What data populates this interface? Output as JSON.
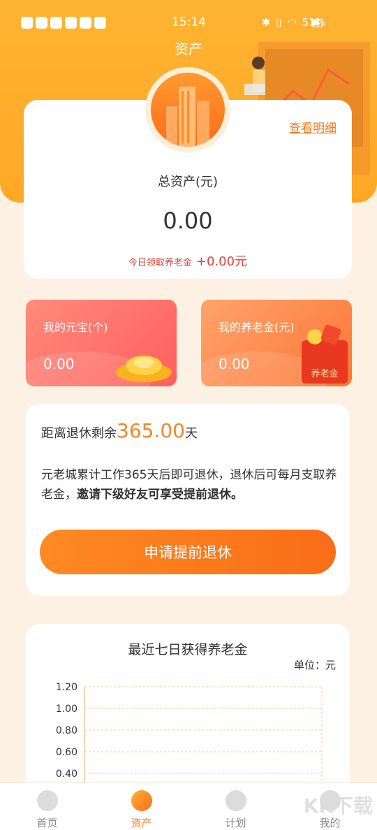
{
  "status_bar": {
    "time": "15:14",
    "battery": "51%"
  },
  "page_title": "资产",
  "asset_card": {
    "detail_link": "查看明细",
    "total_label": "总资产(元)",
    "total_value": "0.00",
    "today_label": "今日领取养老金",
    "today_value": "+0.00元"
  },
  "mini_cards": [
    {
      "label": "我的元宝(个)",
      "value": "0.00"
    },
    {
      "label": "我的养老金(元)",
      "value": "0.00",
      "badge": "养老金"
    }
  ],
  "retire_card": {
    "remain_prefix": "距离退休剩余",
    "remain_days": "365.00",
    "remain_suffix": "天",
    "desc_normal": "元老城累计工作365天后即可退休，退休后可每月支取养老金，",
    "desc_bold": "邀请下级好友可享受提前退休。",
    "apply_button": "申请提前退休"
  },
  "chart_data": {
    "type": "line",
    "title": "最近七日获得养老金",
    "unit_label": "单位：元",
    "y_ticks": [
      "1.20",
      "1.00",
      "0.80",
      "0.60",
      "0.40"
    ],
    "ylim": [
      0,
      1.2
    ],
    "grid": true
  },
  "tabbar": {
    "items": [
      {
        "label": "首页",
        "icon": "home-icon",
        "active": false
      },
      {
        "label": "资产",
        "icon": "assets-icon",
        "active": true
      },
      {
        "label": "计划",
        "icon": "plan-icon",
        "active": false
      },
      {
        "label": "我的",
        "icon": "profile-icon",
        "active": false
      }
    ]
  },
  "watermark": "KK下载",
  "colors": {
    "accent": "#f57c24",
    "hero": "#ffa826",
    "today_red": "#e64234"
  }
}
